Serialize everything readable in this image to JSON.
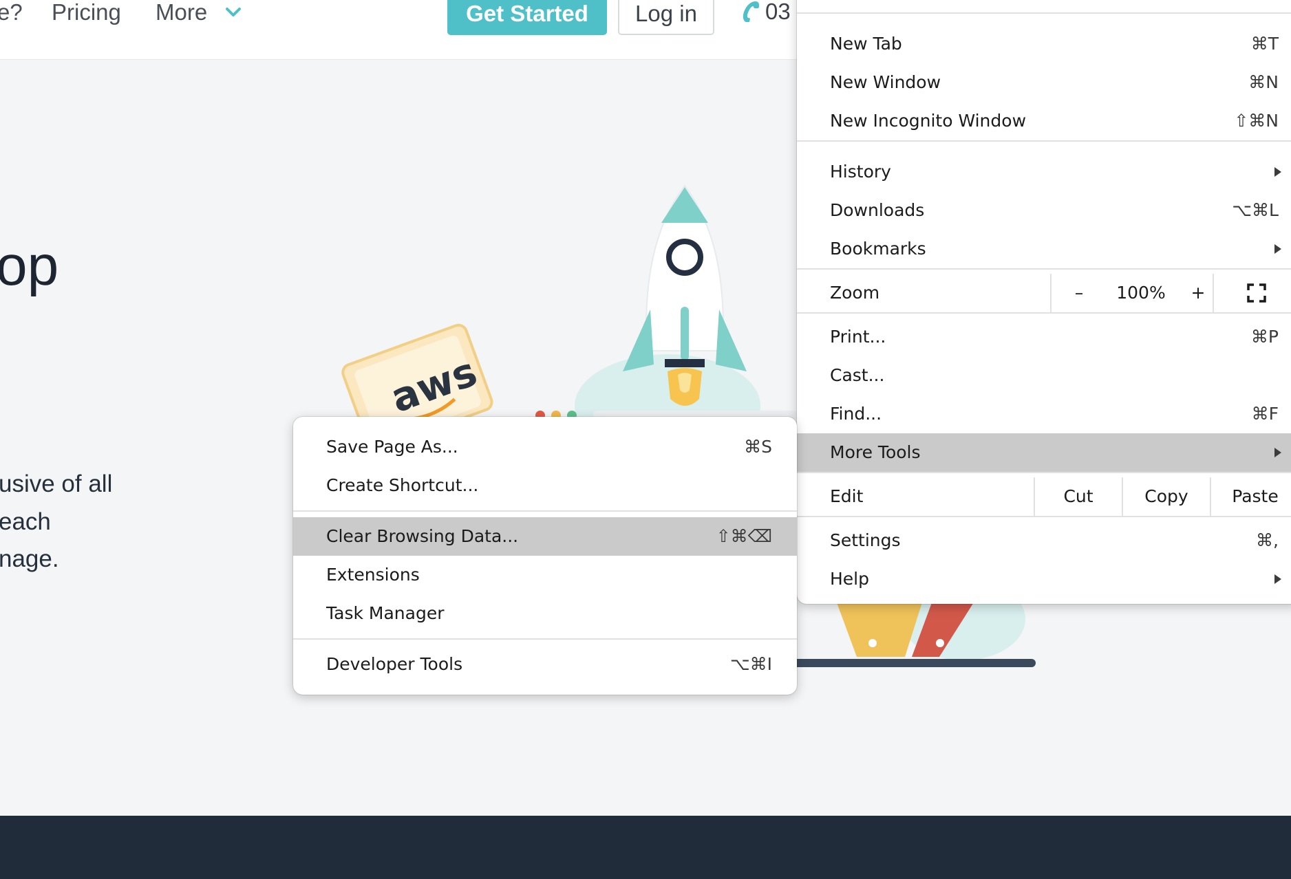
{
  "nav": {
    "partial_item": "e?",
    "pricing": "Pricing",
    "more": "More",
    "get_started": "Get Started",
    "login": "Log in",
    "phone": "03"
  },
  "hero": {
    "headline_fragment": "op",
    "lines": [
      "usive of all",
      "each",
      "nage."
    ]
  },
  "illustration": {
    "card_label": "aws"
  },
  "main_menu": {
    "new_tab": {
      "label": "New Tab",
      "shortcut": "⌘T"
    },
    "new_window": {
      "label": "New Window",
      "shortcut": "⌘N"
    },
    "new_incognito": {
      "label": "New Incognito Window",
      "shortcut": "⇧⌘N"
    },
    "history": {
      "label": "History"
    },
    "downloads": {
      "label": "Downloads",
      "shortcut": "⌥⌘L"
    },
    "bookmarks": {
      "label": "Bookmarks"
    },
    "zoom": {
      "label": "Zoom",
      "minus": "–",
      "value": "100%",
      "plus": "+"
    },
    "print": {
      "label": "Print...",
      "shortcut": "⌘P"
    },
    "cast": {
      "label": "Cast..."
    },
    "find": {
      "label": "Find...",
      "shortcut": "⌘F"
    },
    "more_tools": {
      "label": "More Tools"
    },
    "edit": {
      "label": "Edit",
      "cut": "Cut",
      "copy": "Copy",
      "paste": "Paste"
    },
    "settings": {
      "label": "Settings",
      "shortcut": "⌘,"
    },
    "help": {
      "label": "Help"
    }
  },
  "sub_menu": {
    "save_page": {
      "label": "Save Page As...",
      "shortcut": "⌘S"
    },
    "create_shortcut": {
      "label": "Create Shortcut..."
    },
    "clear_data": {
      "label": "Clear Browsing Data...",
      "shortcut": "⇧⌘⌫"
    },
    "extensions": {
      "label": "Extensions"
    },
    "task_manager": {
      "label": "Task Manager"
    },
    "dev_tools": {
      "label": "Developer Tools",
      "shortcut": "⌥⌘I"
    }
  },
  "colors": {
    "accent_teal": "#4fc0c8",
    "highlight_gray": "#cacaca",
    "footer_navy": "#202c3a"
  }
}
